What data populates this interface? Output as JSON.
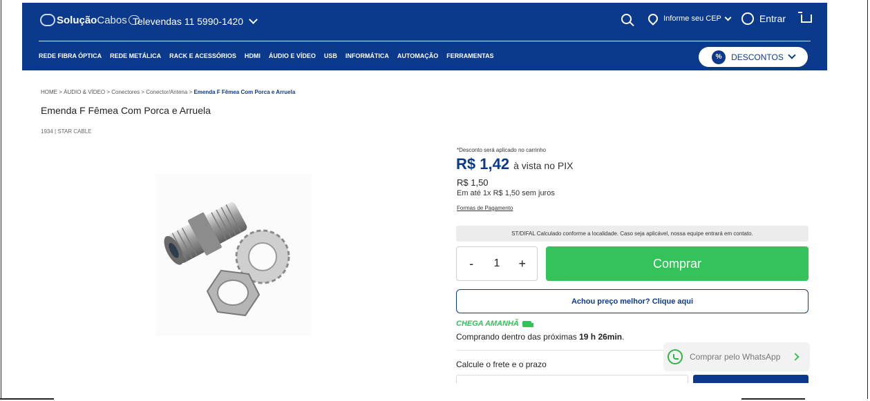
{
  "header": {
    "logo_bold": "Solução",
    "logo_light": "Cabos",
    "televendas": "Televendas 11 5990-1420",
    "cep_label": "Informe seu CEP",
    "login_label": "Entrar",
    "icons": [
      "search-icon",
      "location-pin-icon",
      "user-icon",
      "cart-icon"
    ]
  },
  "nav": {
    "items": [
      "REDE FIBRA ÓPTICA",
      "REDE METÁLICA",
      "RACK E ACESSÓRIOS",
      "HDMI",
      "ÁUDIO E VÍDEO",
      "USB",
      "INFORMÁTICA",
      "AUTOMAÇÃO",
      "FERRAMENTAS"
    ],
    "discount_label": "DESCONTOS",
    "discount_icon": "%"
  },
  "breadcrumb": {
    "path": "HOME > ÁUDIO & VÍDEO > Conectores > Conector/Antena > ",
    "current": "Emenda F Fêmea Com Porca e Arruela"
  },
  "product": {
    "title": "Emenda F Fêmea Com Porca e Arruela",
    "meta": "1934  |  STAR CABLE"
  },
  "pricing": {
    "discount_note": "*Desconto será aplicado no carrinho",
    "pix_price": "R$ 1,42",
    "pix_text": "à vista no PIX",
    "full_price": "R$ 1,50",
    "installments": "Em até 1x R$ 1,50 sem juros",
    "payment_link": "Formas de Pagamento",
    "difal_note": "ST/DIFAL Calculado conforme a localidade. Caso seja aplicável, nossa equipe entrará em contato."
  },
  "purchase": {
    "minus": "-",
    "quantity": "1",
    "plus": "+",
    "buy_label": "Comprar",
    "better_price": "Achou preço melhor? Clique aqui"
  },
  "delivery": {
    "arrives": "CHEGA AMANHÃ",
    "prefix": "Comprando dentro das próximas ",
    "time": "19 h 26min",
    "suffix": "."
  },
  "shipping": {
    "label": "Calcule o frete e o prazo"
  },
  "whatsapp": {
    "label": "Comprar pelo WhatsApp"
  },
  "colors": {
    "brand_blue": "#0b3a8c",
    "buy_green": "#33c35a"
  }
}
